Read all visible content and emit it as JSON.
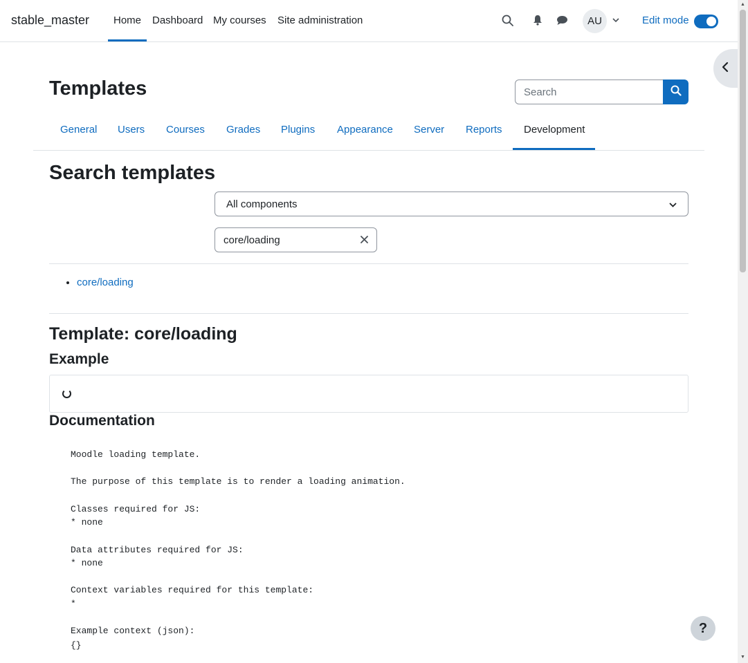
{
  "navbar": {
    "brand": "stable_master",
    "items": [
      {
        "label": "Home",
        "active": true
      },
      {
        "label": "Dashboard"
      },
      {
        "label": "My courses"
      },
      {
        "label": "Site administration"
      }
    ],
    "avatar_initials": "AU",
    "edit_mode_label": "Edit mode",
    "edit_mode_on": true
  },
  "page": {
    "title": "Templates",
    "search_placeholder": "Search"
  },
  "tabs": [
    {
      "label": "General"
    },
    {
      "label": "Users"
    },
    {
      "label": "Courses"
    },
    {
      "label": "Grades"
    },
    {
      "label": "Plugins"
    },
    {
      "label": "Appearance"
    },
    {
      "label": "Server"
    },
    {
      "label": "Reports"
    },
    {
      "label": "Development",
      "active": true
    }
  ],
  "search": {
    "heading": "Search templates",
    "component_selected": "All components",
    "filter_value": "core/loading",
    "results": [
      "core/loading"
    ]
  },
  "template": {
    "title": "Template: core/loading",
    "example_heading": "Example",
    "doc_heading": "Documentation",
    "doc_lines": [
      "Moodle loading template.",
      "",
      "The purpose of this template is to render a loading animation.",
      "",
      "Classes required for JS:",
      "* none",
      "",
      "Data attributes required for JS:",
      "* none",
      "",
      "Context variables required for this template:",
      "*",
      "",
      "Example context (json):",
      "{}"
    ]
  },
  "help_label": "?",
  "colors": {
    "accent": "#0f6cbf",
    "text": "#1d2125",
    "border": "#dee2e6"
  }
}
